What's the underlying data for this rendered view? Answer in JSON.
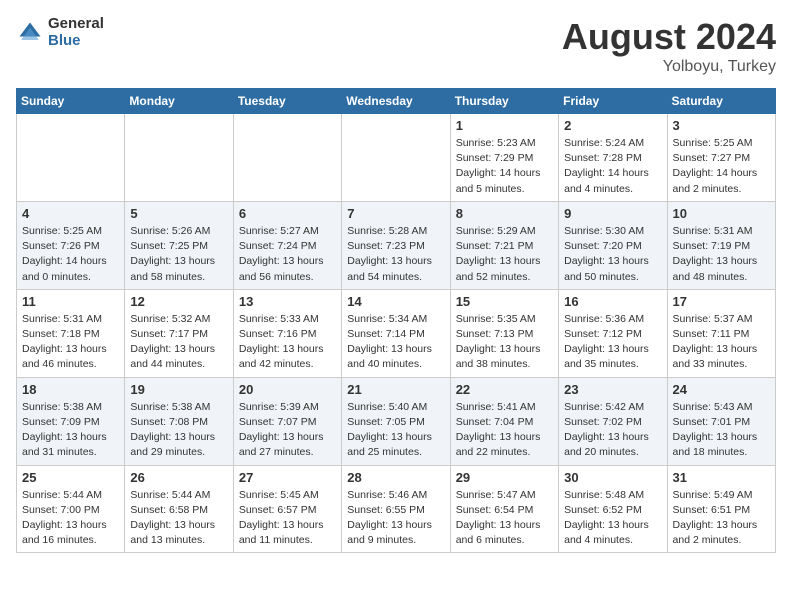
{
  "header": {
    "logo_general": "General",
    "logo_blue": "Blue",
    "title": "August 2024",
    "location": "Yolboyu, Turkey"
  },
  "days_of_week": [
    "Sunday",
    "Monday",
    "Tuesday",
    "Wednesday",
    "Thursday",
    "Friday",
    "Saturday"
  ],
  "weeks": [
    {
      "days": [
        {
          "number": "",
          "info": ""
        },
        {
          "number": "",
          "info": ""
        },
        {
          "number": "",
          "info": ""
        },
        {
          "number": "",
          "info": ""
        },
        {
          "number": "1",
          "info": "Sunrise: 5:23 AM\nSunset: 7:29 PM\nDaylight: 14 hours\nand 5 minutes."
        },
        {
          "number": "2",
          "info": "Sunrise: 5:24 AM\nSunset: 7:28 PM\nDaylight: 14 hours\nand 4 minutes."
        },
        {
          "number": "3",
          "info": "Sunrise: 5:25 AM\nSunset: 7:27 PM\nDaylight: 14 hours\nand 2 minutes."
        }
      ]
    },
    {
      "days": [
        {
          "number": "4",
          "info": "Sunrise: 5:25 AM\nSunset: 7:26 PM\nDaylight: 14 hours\nand 0 minutes."
        },
        {
          "number": "5",
          "info": "Sunrise: 5:26 AM\nSunset: 7:25 PM\nDaylight: 13 hours\nand 58 minutes."
        },
        {
          "number": "6",
          "info": "Sunrise: 5:27 AM\nSunset: 7:24 PM\nDaylight: 13 hours\nand 56 minutes."
        },
        {
          "number": "7",
          "info": "Sunrise: 5:28 AM\nSunset: 7:23 PM\nDaylight: 13 hours\nand 54 minutes."
        },
        {
          "number": "8",
          "info": "Sunrise: 5:29 AM\nSunset: 7:21 PM\nDaylight: 13 hours\nand 52 minutes."
        },
        {
          "number": "9",
          "info": "Sunrise: 5:30 AM\nSunset: 7:20 PM\nDaylight: 13 hours\nand 50 minutes."
        },
        {
          "number": "10",
          "info": "Sunrise: 5:31 AM\nSunset: 7:19 PM\nDaylight: 13 hours\nand 48 minutes."
        }
      ]
    },
    {
      "days": [
        {
          "number": "11",
          "info": "Sunrise: 5:31 AM\nSunset: 7:18 PM\nDaylight: 13 hours\nand 46 minutes."
        },
        {
          "number": "12",
          "info": "Sunrise: 5:32 AM\nSunset: 7:17 PM\nDaylight: 13 hours\nand 44 minutes."
        },
        {
          "number": "13",
          "info": "Sunrise: 5:33 AM\nSunset: 7:16 PM\nDaylight: 13 hours\nand 42 minutes."
        },
        {
          "number": "14",
          "info": "Sunrise: 5:34 AM\nSunset: 7:14 PM\nDaylight: 13 hours\nand 40 minutes."
        },
        {
          "number": "15",
          "info": "Sunrise: 5:35 AM\nSunset: 7:13 PM\nDaylight: 13 hours\nand 38 minutes."
        },
        {
          "number": "16",
          "info": "Sunrise: 5:36 AM\nSunset: 7:12 PM\nDaylight: 13 hours\nand 35 minutes."
        },
        {
          "number": "17",
          "info": "Sunrise: 5:37 AM\nSunset: 7:11 PM\nDaylight: 13 hours\nand 33 minutes."
        }
      ]
    },
    {
      "days": [
        {
          "number": "18",
          "info": "Sunrise: 5:38 AM\nSunset: 7:09 PM\nDaylight: 13 hours\nand 31 minutes."
        },
        {
          "number": "19",
          "info": "Sunrise: 5:38 AM\nSunset: 7:08 PM\nDaylight: 13 hours\nand 29 minutes."
        },
        {
          "number": "20",
          "info": "Sunrise: 5:39 AM\nSunset: 7:07 PM\nDaylight: 13 hours\nand 27 minutes."
        },
        {
          "number": "21",
          "info": "Sunrise: 5:40 AM\nSunset: 7:05 PM\nDaylight: 13 hours\nand 25 minutes."
        },
        {
          "number": "22",
          "info": "Sunrise: 5:41 AM\nSunset: 7:04 PM\nDaylight: 13 hours\nand 22 minutes."
        },
        {
          "number": "23",
          "info": "Sunrise: 5:42 AM\nSunset: 7:02 PM\nDaylight: 13 hours\nand 20 minutes."
        },
        {
          "number": "24",
          "info": "Sunrise: 5:43 AM\nSunset: 7:01 PM\nDaylight: 13 hours\nand 18 minutes."
        }
      ]
    },
    {
      "days": [
        {
          "number": "25",
          "info": "Sunrise: 5:44 AM\nSunset: 7:00 PM\nDaylight: 13 hours\nand 16 minutes."
        },
        {
          "number": "26",
          "info": "Sunrise: 5:44 AM\nSunset: 6:58 PM\nDaylight: 13 hours\nand 13 minutes."
        },
        {
          "number": "27",
          "info": "Sunrise: 5:45 AM\nSunset: 6:57 PM\nDaylight: 13 hours\nand 11 minutes."
        },
        {
          "number": "28",
          "info": "Sunrise: 5:46 AM\nSunset: 6:55 PM\nDaylight: 13 hours\nand 9 minutes."
        },
        {
          "number": "29",
          "info": "Sunrise: 5:47 AM\nSunset: 6:54 PM\nDaylight: 13 hours\nand 6 minutes."
        },
        {
          "number": "30",
          "info": "Sunrise: 5:48 AM\nSunset: 6:52 PM\nDaylight: 13 hours\nand 4 minutes."
        },
        {
          "number": "31",
          "info": "Sunrise: 5:49 AM\nSunset: 6:51 PM\nDaylight: 13 hours\nand 2 minutes."
        }
      ]
    }
  ]
}
